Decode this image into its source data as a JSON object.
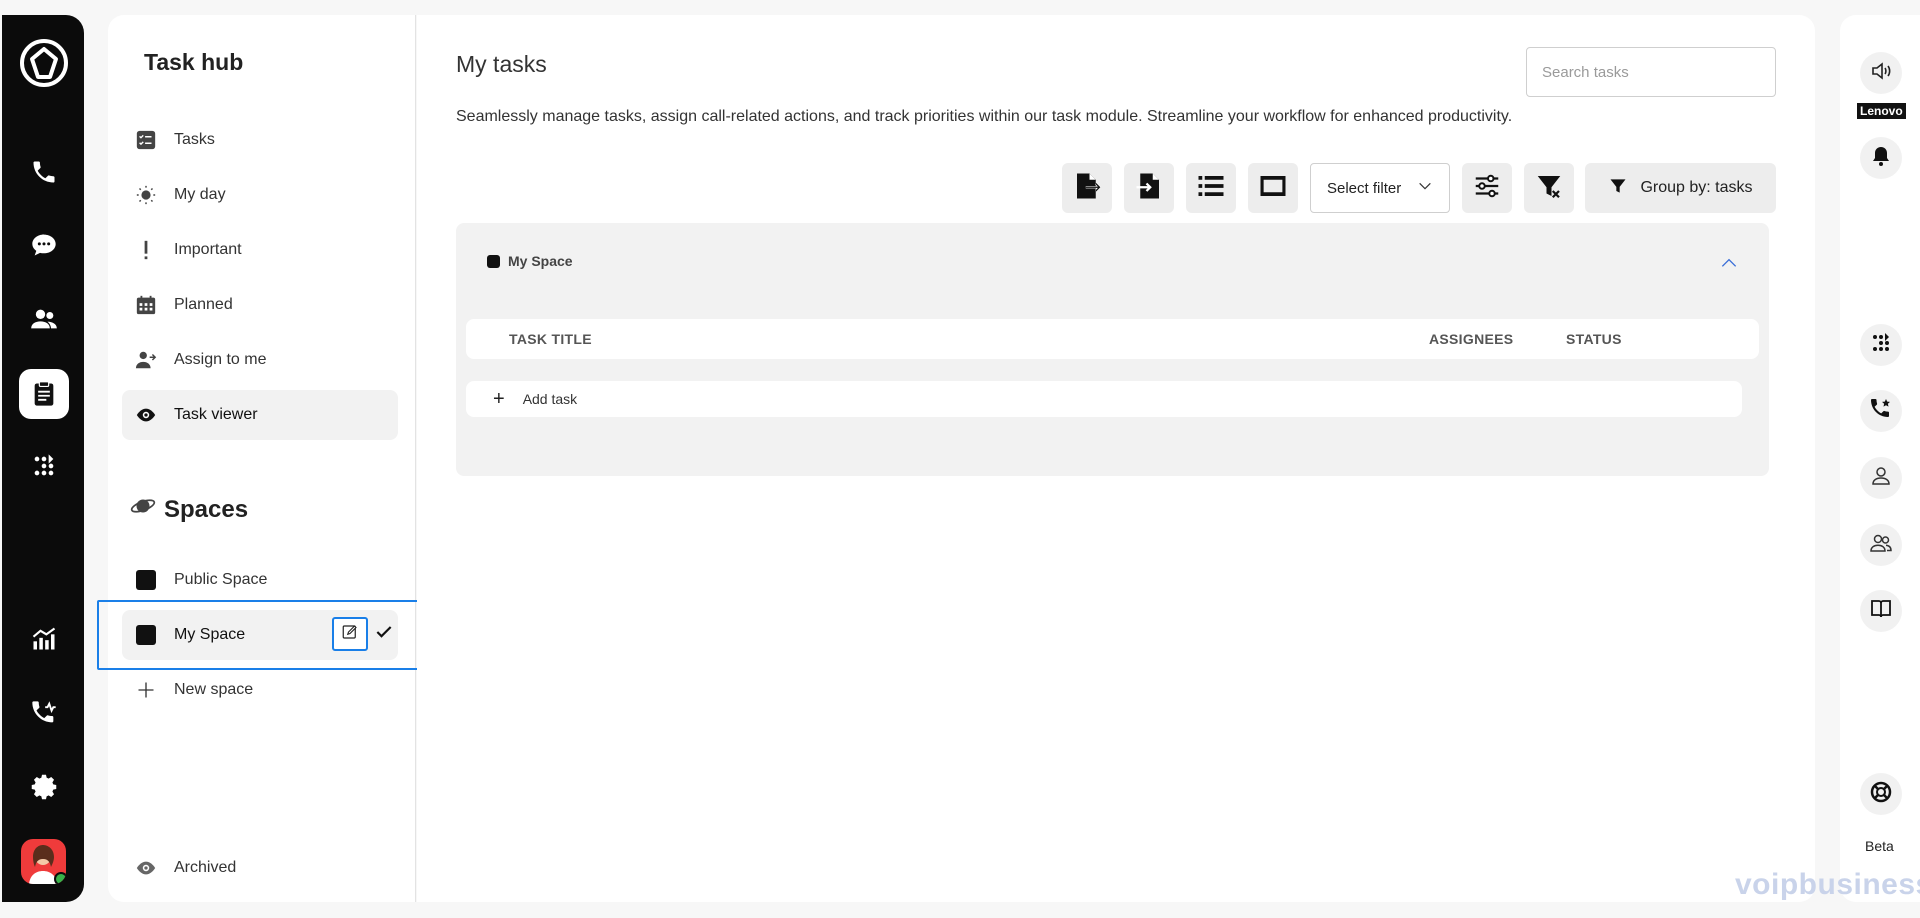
{
  "sidebar": {
    "title": "Task hub",
    "items": [
      {
        "label": "Tasks"
      },
      {
        "label": "My day"
      },
      {
        "label": "Important"
      },
      {
        "label": "Planned"
      },
      {
        "label": "Assign to me"
      },
      {
        "label": "Task viewer"
      }
    ],
    "spaces_title": "Spaces",
    "spaces": [
      {
        "label": "Public Space"
      },
      {
        "label": "My Space"
      }
    ],
    "new_space": "New space",
    "archived": "Archived"
  },
  "main": {
    "title": "My tasks",
    "search_placeholder": "Search tasks",
    "description": "Seamlessly manage tasks, assign call-related actions, and track priorities within our task module. Streamline your workflow for enhanced productivity.",
    "select_filter": "Select filter",
    "group_by": "Group by: tasks",
    "group": {
      "name": "My Space",
      "columns": [
        "TASK TITLE",
        "ASSIGNEES",
        "STATUS"
      ],
      "add_task": "Add task"
    }
  },
  "right_rail": {
    "device_label": "Lenovo",
    "beta_label": "Beta"
  },
  "watermark": "voipbusiness",
  "colors": {
    "accent": "#1a7fe8",
    "rail_bg": "#0b0b0b",
    "avatar_bg": "#ef3b3b",
    "status_online": "#38b24a"
  }
}
